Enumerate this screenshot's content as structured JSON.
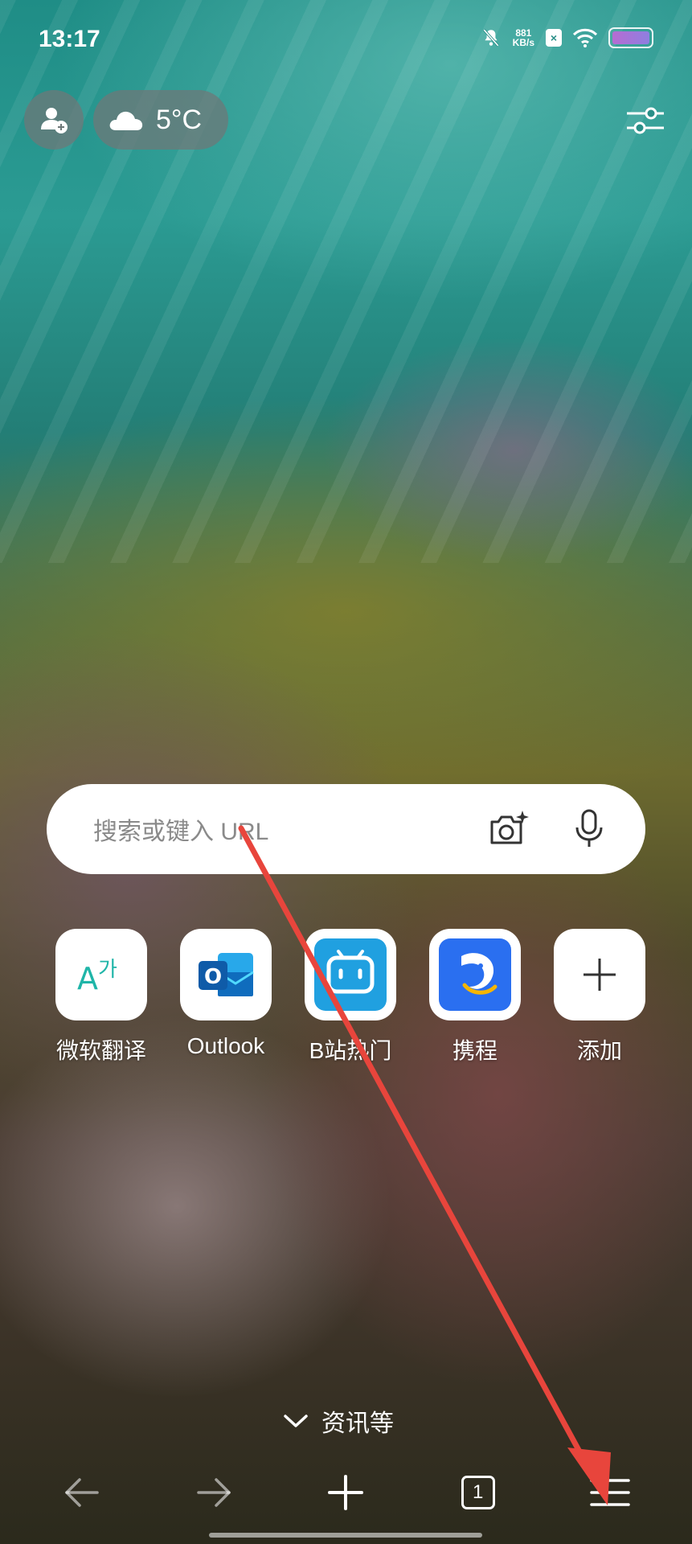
{
  "status_bar": {
    "time": "13:17",
    "net_speed_value": "881",
    "net_speed_unit": "KB/s",
    "icons": [
      "mute-icon",
      "sim-disabled-icon",
      "wifi-icon",
      "battery-icon"
    ]
  },
  "top": {
    "profile_icon": "add-profile-icon",
    "weather_icon": "cloud-icon",
    "temperature": "5°C",
    "settings_icon": "sliders-icon"
  },
  "search": {
    "placeholder": "搜索或键入 URL",
    "camera_icon": "visual-search-camera-icon",
    "mic_icon": "microphone-icon"
  },
  "shortcuts": [
    {
      "label": "微软翻译",
      "icon": "translator-icon"
    },
    {
      "label": "Outlook",
      "icon": "outlook-icon"
    },
    {
      "label": "B站热门",
      "icon": "bilibili-icon"
    },
    {
      "label": "携程",
      "icon": "ctrip-icon"
    },
    {
      "label": "添加",
      "icon": "plus-icon"
    }
  ],
  "feed": {
    "label": "资讯等",
    "icon": "chevron-down-icon"
  },
  "bottom_bar": {
    "tab_count": "1",
    "items": [
      "back-arrow-icon",
      "forward-arrow-icon",
      "new-tab-plus-icon",
      "tabs-count-icon",
      "menu-icon"
    ]
  },
  "colors": {
    "annotation_arrow": "#e8453c",
    "translator_accent": "#1fb5a8",
    "outlook_blue": "#0f6cbd",
    "bilibili_blue": "#20a0e0",
    "ctrip_blue": "#2a6ff0"
  }
}
